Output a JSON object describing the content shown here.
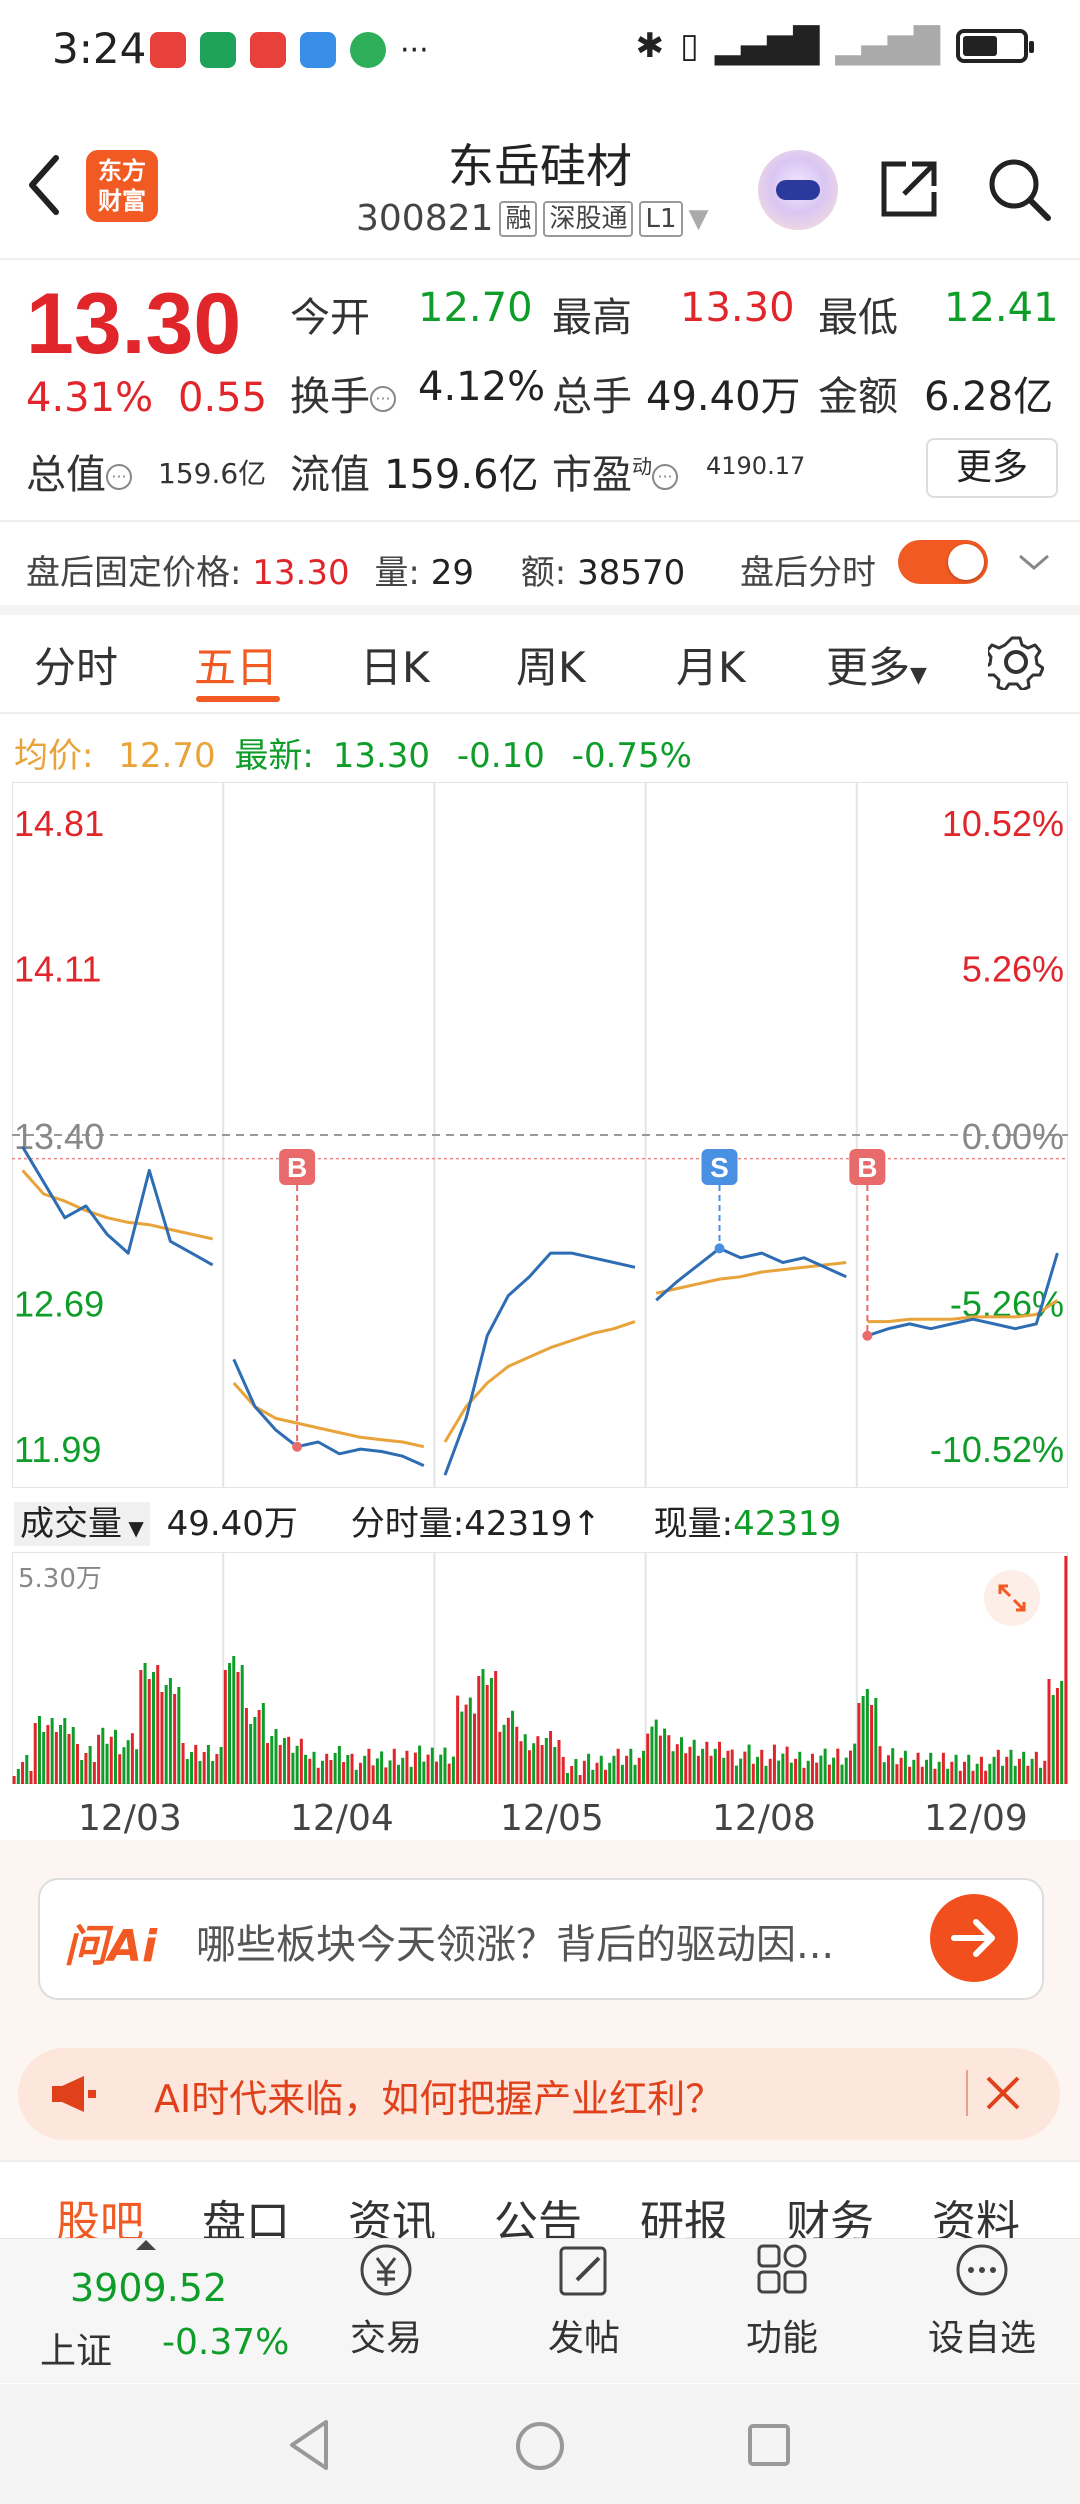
{
  "status_bar": {
    "time": "3:24",
    "more": "···",
    "battery_level": 0.55,
    "app_icon_colors": [
      "#e8403a",
      "#1fa35a",
      "#e8403a",
      "#3a8ee8",
      "#2fae5a"
    ]
  },
  "header": {
    "stock_name": "东岳硅材",
    "code": "300821",
    "tags": [
      "融",
      "深股通",
      "L1"
    ],
    "logo_text_top": "东方",
    "logo_text_bottom": "财富"
  },
  "quote": {
    "price": "13.30",
    "change_pct": "4.31%",
    "change_abs": "0.55",
    "open_label": "今开",
    "open": "12.70",
    "high_label": "最高",
    "high": "13.30",
    "low_label": "最低",
    "low": "12.41",
    "turnover_label": "换手",
    "turnover": "4.12%",
    "volume_label": "总手",
    "volume": "49.40万",
    "amount_label": "金额",
    "amount": "6.28亿",
    "mktcap_label": "总值",
    "mktcap": "159.6亿",
    "float_label": "流值",
    "float_cap": "159.6亿",
    "pe_label": "市盈",
    "pe_sup": "动",
    "pe": "4190.17",
    "more_button": "更多"
  },
  "after_hours": {
    "label": "盘后固定价格:",
    "price": "13.30",
    "qty_label": "量:",
    "qty": "29",
    "amt_label": "额:",
    "amt": "38570",
    "toggle_label": "盘后分时",
    "toggle_on": true
  },
  "tabs": [
    "分时",
    "五日",
    "日K",
    "周K",
    "月K",
    "更多"
  ],
  "active_tab": "五日",
  "chart_header": {
    "avg_label": "均价:",
    "avg": "12.70",
    "latest_label": "最新:",
    "latest": "13.30",
    "latest_chg": "-0.10",
    "latest_pct": "-0.75%"
  },
  "chart_data": {
    "type": "line",
    "y_ticks_left": [
      "14.81",
      "14.11",
      "13.40",
      "12.69",
      "11.99"
    ],
    "y_ticks_right": [
      "10.52%",
      "5.26%",
      "0.00%",
      "-5.26%",
      "-10.52%"
    ],
    "ylim": [
      11.99,
      14.81
    ],
    "ref_price": 13.4,
    "x_categories": [
      "12/03",
      "12/04",
      "12/05",
      "12/08",
      "12/09"
    ],
    "series": [
      {
        "color": "#2e6db4",
        "values": [
          13.35,
          13.2,
          13.05,
          13.1,
          12.98,
          12.9,
          13.25,
          12.95,
          12.9,
          12.85,
          12.45,
          12.25,
          12.15,
          12.08,
          12.1,
          12.05,
          12.07,
          12.06,
          12.04,
          12.0,
          11.96,
          12.2,
          12.55,
          12.72,
          12.8,
          12.9,
          12.9,
          12.88,
          12.86,
          12.84,
          12.7,
          12.78,
          12.85,
          12.92,
          12.88,
          12.9,
          12.86,
          12.88,
          12.84,
          12.8,
          12.55,
          12.58,
          12.6,
          12.58,
          12.6,
          12.62,
          12.6,
          12.58,
          12.6,
          12.9
        ]
      },
      {
        "color": "#e8a33a",
        "values": [
          13.25,
          13.15,
          13.12,
          13.08,
          13.05,
          13.03,
          13.02,
          13.0,
          12.98,
          12.96,
          12.35,
          12.25,
          12.2,
          12.18,
          12.16,
          12.14,
          12.12,
          12.11,
          12.1,
          12.08,
          12.1,
          12.25,
          12.35,
          12.42,
          12.46,
          12.5,
          12.53,
          12.56,
          12.58,
          12.61,
          12.73,
          12.75,
          12.77,
          12.79,
          12.8,
          12.82,
          12.83,
          12.84,
          12.85,
          12.86,
          12.61,
          12.61,
          12.62,
          12.62,
          12.62,
          12.63,
          12.63,
          12.63,
          12.64,
          12.7
        ]
      }
    ],
    "markers": [
      {
        "label": "B",
        "color": "#e86a6a",
        "index": 13
      },
      {
        "label": "S",
        "color": "#4a90e2",
        "index": 33
      },
      {
        "label": "B",
        "color": "#e86a6a",
        "index": 40
      }
    ]
  },
  "volume": {
    "label": "成交量",
    "total": "49.40万",
    "tick_label": "分时量:",
    "tick_value": "42319↑",
    "now_label": "现量:",
    "now_value": "42319",
    "max_label": "5.30万"
  },
  "ai_search": {
    "logo": "问Ai",
    "placeholder": "哪些板块今天领涨？背后的驱动因..."
  },
  "banner": {
    "text": "AI时代来临，如何把握产业红利？"
  },
  "bottom_tabs": [
    "股吧",
    "盘口",
    "资讯",
    "公告",
    "研报",
    "财务",
    "资料"
  ],
  "bottom_nav": {
    "index_value": "3909.52",
    "index_name": "上证",
    "index_pct": "-0.37%",
    "items": [
      "交易",
      "发帖",
      "功能",
      "设自选"
    ]
  },
  "colors": {
    "up": "#e0252b",
    "down": "#0f9d2a",
    "accent": "#f15a22",
    "price_line": "#2e6db4",
    "avg_line": "#e8a33a"
  }
}
